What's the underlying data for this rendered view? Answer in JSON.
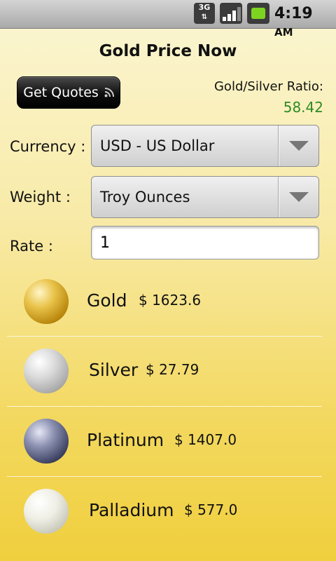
{
  "status_bar": {
    "network": "3G",
    "time": "4:19",
    "ampm": "AM",
    "icons": [
      "3g-data-icon",
      "signal-icon",
      "battery-charging-icon"
    ]
  },
  "header": {
    "title": "Gold Price Now"
  },
  "quotes_button": {
    "label": "Get Quotes",
    "icon": "rss-icon"
  },
  "ratio": {
    "label": "Gold/Silver Ratio:",
    "value": "58.42",
    "value_color": "#2e8b24"
  },
  "form": {
    "currency": {
      "label": "Currency :",
      "value": "USD - US Dollar"
    },
    "weight": {
      "label": "Weight :",
      "value": "Troy Ounces"
    },
    "rate": {
      "label": "Rate :",
      "value": "1"
    }
  },
  "metals": [
    {
      "name": "Gold",
      "price": "$ 1623.6",
      "color": "#d9a521"
    },
    {
      "name": "Silver",
      "price": "$ 27.79",
      "color": "#c9c9c9"
    },
    {
      "name": "Platinum",
      "price": "$ 1407.0",
      "color": "#5a5f7a"
    },
    {
      "name": "Palladium",
      "price": "$ 577.0",
      "color": "#e4e4d8"
    }
  ]
}
